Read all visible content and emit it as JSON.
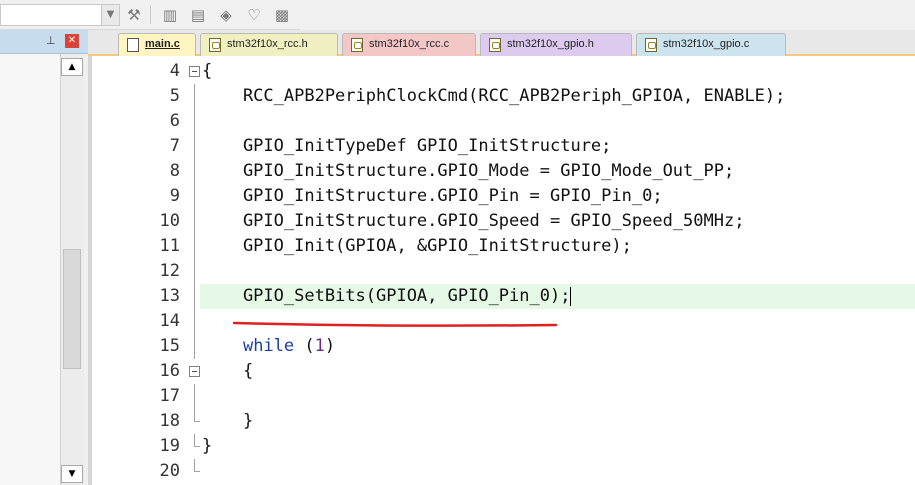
{
  "toolbar": {
    "icons": [
      "combo-dropdown-icon",
      "magic-wand-icon",
      "build-icon",
      "batch-build-icon",
      "diamond-icon",
      "bucket-icon",
      "options-icon"
    ]
  },
  "left_panel": {
    "pin_glyph": "⊥",
    "close_glyph": "✕",
    "scroll_up_glyph": "▲",
    "scroll_down_glyph": "▼"
  },
  "tabs": [
    {
      "label": "main.c",
      "active": true,
      "color": "#fff5c2"
    },
    {
      "label": "stm32f10x_rcc.h",
      "active": false,
      "color": "#efefc0"
    },
    {
      "label": "stm32f10x_rcc.c",
      "active": false,
      "color": "#f4c7c7"
    },
    {
      "label": "stm32f10x_gpio.h",
      "active": false,
      "color": "#dccbee"
    },
    {
      "label": "stm32f10x_gpio.c",
      "active": false,
      "color": "#cde3ee"
    }
  ],
  "editor": {
    "lines": [
      {
        "num": "4",
        "text": "{"
      },
      {
        "num": "5",
        "text": "    RCC_APB2PeriphClockCmd(RCC_APB2Periph_GPIOA, ENABLE);"
      },
      {
        "num": "6",
        "text": ""
      },
      {
        "num": "7",
        "text": "    GPIO_InitTypeDef GPIO_InitStructure;"
      },
      {
        "num": "8",
        "text": "    GPIO_InitStructure.GPIO_Mode = GPIO_Mode_Out_PP;"
      },
      {
        "num": "9",
        "text": "    GPIO_InitStructure.GPIO_Pin = GPIO_Pin_0;"
      },
      {
        "num": "10",
        "text": "    GPIO_InitStructure.GPIO_Speed = GPIO_Speed_50MHz;"
      },
      {
        "num": "11",
        "text": "    GPIO_Init(GPIOA, &GPIO_InitStructure);"
      },
      {
        "num": "12",
        "text": ""
      },
      {
        "num": "13",
        "text": "    GPIO_SetBits(GPIOA, GPIO_Pin_0);"
      },
      {
        "num": "14",
        "text": ""
      },
      {
        "num": "15",
        "kw": "while",
        "open": " (",
        "n": "1",
        "close": ")"
      },
      {
        "num": "16",
        "text": "    {"
      },
      {
        "num": "17",
        "text": ""
      },
      {
        "num": "18",
        "text": "    }"
      },
      {
        "num": "19",
        "text": "}"
      },
      {
        "num": "20",
        "text": ""
      }
    ],
    "highlight_color": "#e6f9e6",
    "keyword_color": "#1b3fa5",
    "annotation_color": "#e02020"
  }
}
